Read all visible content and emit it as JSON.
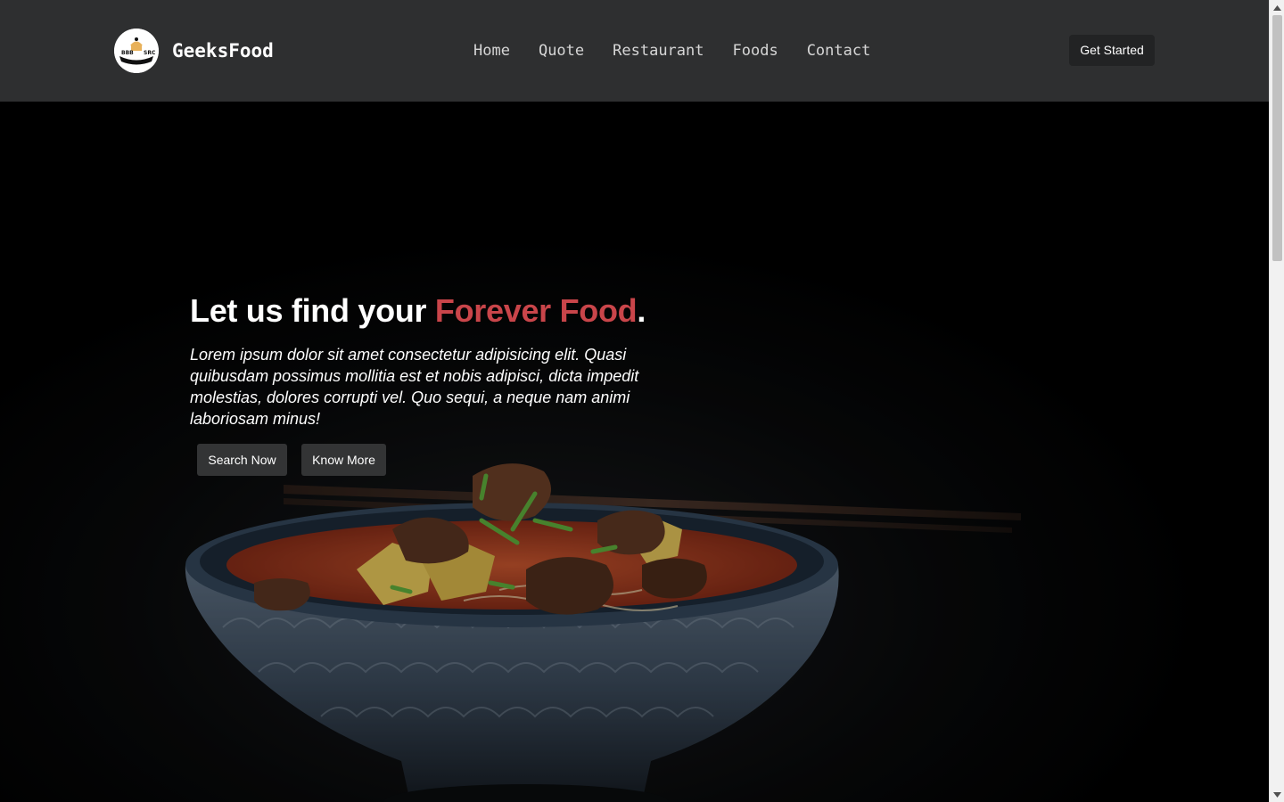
{
  "brand": {
    "name": "GeeksFood",
    "logo_icon": "food-logo-icon"
  },
  "nav": {
    "items": [
      {
        "label": "Home"
      },
      {
        "label": "Quote"
      },
      {
        "label": "Restaurant"
      },
      {
        "label": "Foods"
      },
      {
        "label": "Contact"
      }
    ],
    "cta_label": "Get Started"
  },
  "hero": {
    "headline_prefix": "Let us find your ",
    "headline_accent": "Forever Food",
    "headline_suffix": ".",
    "description": "Lorem ipsum dolor sit amet consectetur adipisicing elit. Quasi quibusdam possimus mollitia est et nobis adipisci, dicta impedit molestias, dolores corrupti vel. Quo sequi, a neque nam animi laboriosam minus!",
    "primary_button": "Search Now",
    "secondary_button": "Know More",
    "background_image": "noodle-soup-bowl-with-beef-and-chopsticks"
  },
  "colors": {
    "navbar_bg": "#2e2f30",
    "accent": "#c9454a",
    "button_bg": "#333435"
  }
}
